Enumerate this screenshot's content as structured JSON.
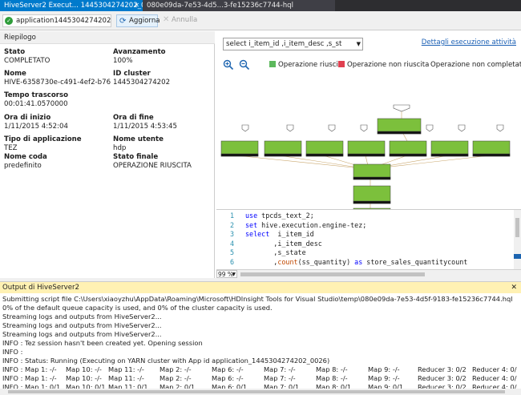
{
  "tabs": [
    {
      "label": "HiveServer2 Execut... 1445304274202_0026"
    },
    {
      "label": "080e09da-7e53-4d5...3-fe15236c7744-hql"
    }
  ],
  "toolbar": {
    "application": "application1445304274202_0026",
    "refresh": "Aggiorna",
    "kill": "Annulla"
  },
  "summary": {
    "header": "Riepilogo",
    "fields": [
      {
        "label": "Stato",
        "value": "COMPLETATO"
      },
      {
        "label": "Avanzamento",
        "value": "100%"
      },
      {
        "label": "Nome",
        "value": "HIVE-6358730e-c491-4ef2-b76"
      },
      {
        "label": "ID cluster",
        "value": "1445304274202"
      },
      {
        "label": "Tempo trascorso",
        "value": "00:01:41.0570000"
      },
      {
        "label": "Ora di inizio",
        "value": "1/11/2015 4:52:04"
      },
      {
        "label": "Ora di fine",
        "value": "1/11/2015 4:53:45"
      },
      {
        "label": "Tipo di applicazione",
        "value": "TEZ"
      },
      {
        "label": "Nome utente",
        "value": "hdp"
      },
      {
        "label": "Nome coda",
        "value": "predefinito"
      },
      {
        "label": "Stato finale",
        "value": "OPERAZIONE RIUSCITA"
      }
    ]
  },
  "graph": {
    "query_select": "select i_item_id         ,i_item_desc         ,s_st",
    "details_link": "Dettagli esecuzione attività",
    "legend": [
      {
        "label": "Operazione riuscita",
        "color": "#5cb85c"
      },
      {
        "label": "Operazione non riuscita",
        "color": "#e04050"
      },
      {
        "label": "Operazione non completata",
        "color": ""
      }
    ],
    "success_color": "#7cc03c"
  },
  "editor": {
    "lines": [
      {
        "n": "1",
        "parts": [
          {
            "t": "use",
            "c": "kw"
          },
          {
            "t": " tpcds_text_2;",
            "c": ""
          }
        ]
      },
      {
        "n": "2",
        "parts": [
          {
            "t": "set",
            "c": "kw"
          },
          {
            "t": " hive.execution.engine-tez;",
            "c": ""
          }
        ]
      },
      {
        "n": "3",
        "parts": [
          {
            "t": "select",
            "c": "kw"
          },
          {
            "t": "  i_item_id",
            "c": ""
          }
        ]
      },
      {
        "n": "4",
        "parts": [
          {
            "t": "       ,i_item_desc",
            "c": ""
          }
        ]
      },
      {
        "n": "5",
        "parts": [
          {
            "t": "       ,s_state",
            "c": ""
          }
        ]
      },
      {
        "n": "6",
        "parts": [
          {
            "t": "       ,",
            "c": ""
          },
          {
            "t": "count",
            "c": "fn"
          },
          {
            "t": "(ss_quantity) ",
            "c": ""
          },
          {
            "t": "as",
            "c": "kw"
          },
          {
            "t": " store_sales_quantitycount",
            "c": ""
          }
        ]
      }
    ],
    "zoom": "99 %"
  },
  "output": {
    "title": "Output di HiveServer2",
    "lines": [
      "Submitting script file C:\\Users\\xiaoyzhu\\AppData\\Roaming\\Microsoft\\HDInsight Tools for Visual Studio\\temp\\080e09da-7e53-4d5f-9183-fe15236c7744.hql",
      "0% of the default queue capacity is used, and 0% of the cluster capacity is used.",
      "Streaming logs and outputs from HiveServer2...",
      "Streaming logs and outputs from HiveServer2...",
      "Streaming logs and outputs from HiveServer2...",
      "INFO : Tez session hasn't been created yet. Opening session",
      "INFO :",
      "INFO : Status: Running (Executing on YARN cluster with App id application_1445304274202_0026)"
    ],
    "progress_rows": [
      [
        "INFO : Map 1: -/-",
        "Map 10: -/-",
        "Map 11: -/-",
        "Map 2: -/-",
        "Map 6: -/-",
        "Map 7: -/-",
        "Map 8: -/-",
        "Map 9: -/-",
        "Reducer 3: 0/2",
        "Reducer 4: 0/"
      ],
      [
        "INFO : Map 1: -/-",
        "Map 10: -/-",
        "Map 11: -/-",
        "Map 2: -/-",
        "Map 6: -/-",
        "Map 7: -/-",
        "Map 8: -/-",
        "Map 9: -/-",
        "Reducer 3: 0/2",
        "Reducer 4: 0/"
      ],
      [
        "INFO : Map 1: 0/1",
        "Map 10: 0/1",
        "Map 11: 0/1",
        "Map 2: 0/1",
        "Map 6: 0/1",
        "Map 7: 0/1",
        "Map 8: 0/1",
        "Map 9: 0/1",
        "Reducer 3: 0/2",
        "Reducer 4: 0/"
      ]
    ]
  }
}
